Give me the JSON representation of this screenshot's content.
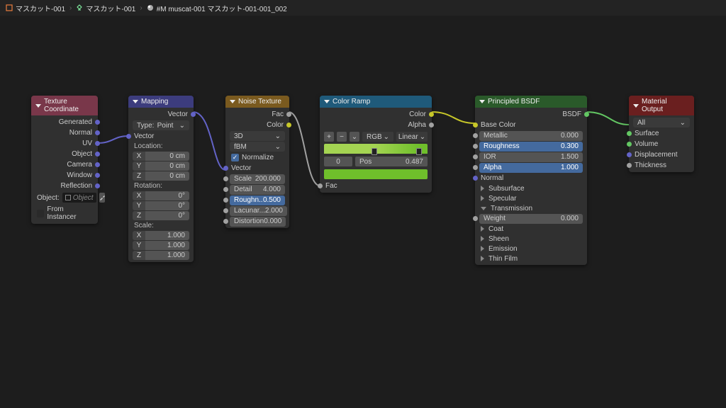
{
  "breadcrumb": {
    "item1": "マスカット-001",
    "item2": "マスカット-001",
    "item3": "#M muscat-001 マスカット-001-001_002"
  },
  "nodes": {
    "texcoord": {
      "title": "Texture Coordinate",
      "outputs": [
        "Generated",
        "Normal",
        "UV",
        "Object",
        "Camera",
        "Window",
        "Reflection"
      ],
      "object_label": "Object:",
      "object_field": "Object",
      "from_instancer": "From Instancer"
    },
    "mapping": {
      "title": "Mapping",
      "out_vector": "Vector",
      "type_label": "Type:",
      "type_value": "Point",
      "in_vector": "Vector",
      "location": "Location:",
      "loc_x": "0 cm",
      "loc_y": "0 cm",
      "loc_z": "0 cm",
      "rotation": "Rotation:",
      "rot_x": "0°",
      "rot_y": "0°",
      "rot_z": "0°",
      "scale": "Scale:",
      "sc_x": "1.000",
      "sc_y": "1.000",
      "sc_z": "1.000"
    },
    "noise": {
      "title": "Noise Texture",
      "out_fac": "Fac",
      "out_color": "Color",
      "dim": "3D",
      "mode": "fBM",
      "normalize": "Normalize",
      "in_vector": "Vector",
      "scale_l": "Scale",
      "scale_v": "200.000",
      "detail_l": "Detail",
      "detail_v": "4.000",
      "rough_l": "Roughn..",
      "rough_v": "0.500",
      "lac_l": "Lacunar...",
      "lac_v": "2.000",
      "dist_l": "Distortion",
      "dist_v": "0.000"
    },
    "ramp": {
      "title": "Color Ramp",
      "out_color": "Color",
      "out_alpha": "Alpha",
      "rgb": "RGB",
      "linear": "Linear",
      "idx": "0",
      "pos_l": "Pos",
      "pos_v": "0.487",
      "in_fac": "Fac",
      "grad_start": "#a4d452",
      "grad_end": "#6fbf2b",
      "swatch": "#6fbf2b",
      "h1": 0.487,
      "h2": 0.92
    },
    "bsdf": {
      "title": "Principled BSDF",
      "out": "BSDF",
      "base": "Base Color",
      "metallic_l": "Metallic",
      "metallic_v": "0.000",
      "rough_l": "Roughness",
      "rough_v": "0.300",
      "ior_l": "IOR",
      "ior_v": "1.500",
      "alpha_l": "Alpha",
      "alpha_v": "1.000",
      "normal": "Normal",
      "sub": "Subsurface",
      "spec": "Specular",
      "trans": "Transmission",
      "weight_l": "Weight",
      "weight_v": "0.000",
      "coat": "Coat",
      "sheen": "Sheen",
      "emis": "Emission",
      "thin": "Thin Film"
    },
    "output": {
      "title": "Material Output",
      "target": "All",
      "surface": "Surface",
      "volume": "Volume",
      "disp": "Displacement",
      "thick": "Thickness"
    }
  },
  "colors": {
    "hdr_texcoord": "#79374a",
    "hdr_mapping": "#3c3c7d",
    "hdr_noise": "#7a5a1f",
    "hdr_ramp": "#1f5a7a",
    "hdr_bsdf": "#2a5a2a",
    "hdr_output": "#6a1f1f"
  }
}
